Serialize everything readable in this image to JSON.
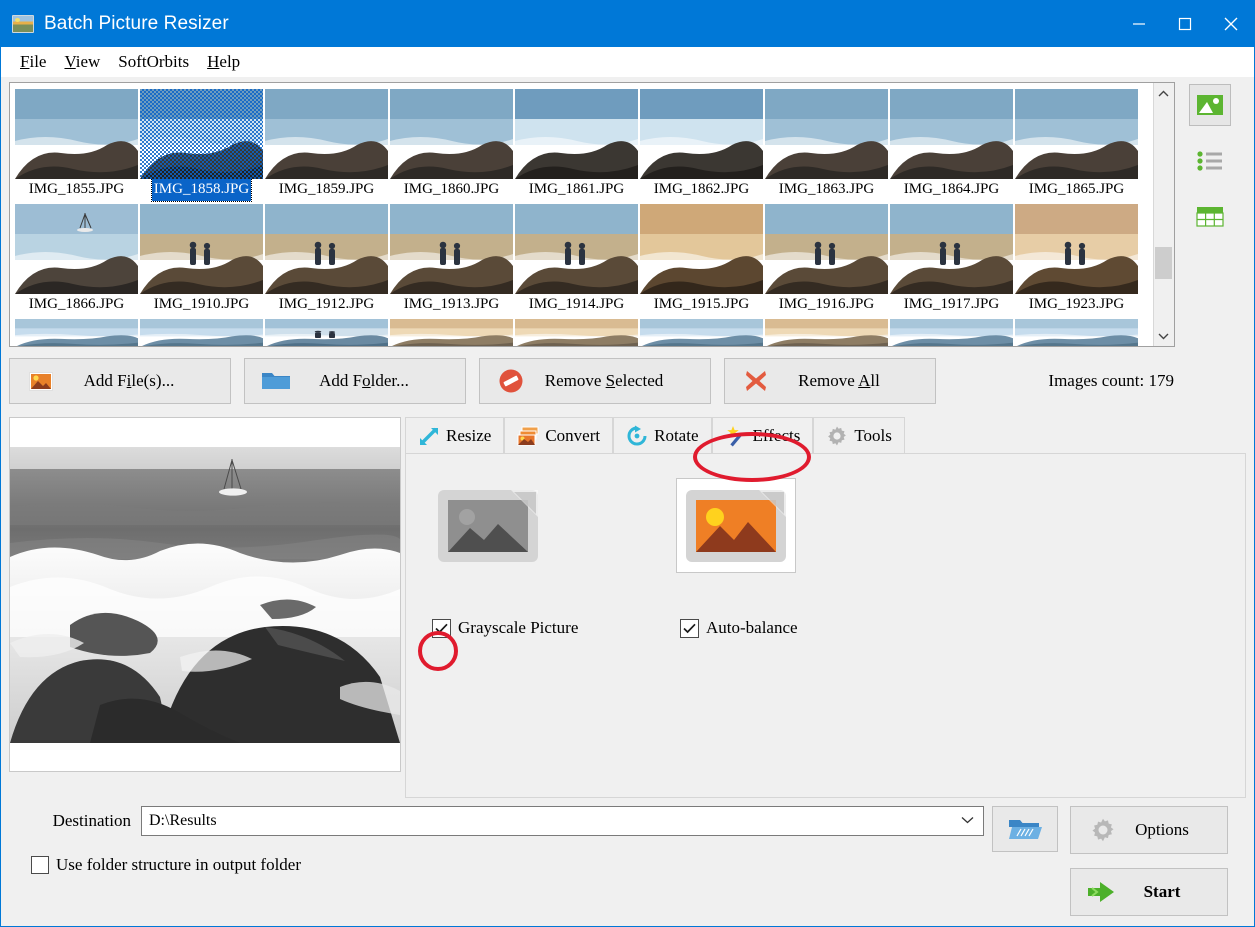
{
  "window": {
    "title": "Batch Picture Resizer",
    "icon": "app-picture-icon",
    "accent_color": "#0078d7",
    "controls": {
      "minimize": "minimize",
      "maximize": "maximize",
      "close": "close"
    }
  },
  "menubar": {
    "items": [
      {
        "label": "File",
        "mnemonic": "F"
      },
      {
        "label": "View",
        "mnemonic": "V"
      },
      {
        "label": "SoftOrbits",
        "mnemonic": ""
      },
      {
        "label": "Help",
        "mnemonic": "H"
      }
    ]
  },
  "thumbnails": {
    "selected": "IMG_1858.JPG",
    "items": [
      {
        "name": "IMG_1855.JPG",
        "kind": "rocks-sea"
      },
      {
        "name": "IMG_1858.JPG",
        "kind": "wave-splash"
      },
      {
        "name": "IMG_1859.JPG",
        "kind": "rocks-sea"
      },
      {
        "name": "IMG_1860.JPG",
        "kind": "rocks-sea"
      },
      {
        "name": "IMG_1861.JPG",
        "kind": "wave-splash"
      },
      {
        "name": "IMG_1862.JPG",
        "kind": "wave-splash"
      },
      {
        "name": "IMG_1863.JPG",
        "kind": "rocks-sea"
      },
      {
        "name": "IMG_1864.JPG",
        "kind": "rocks-sea"
      },
      {
        "name": "IMG_1865.JPG",
        "kind": "rocks-sea"
      },
      {
        "name": "IMG_1866.JPG",
        "kind": "sailboat-sea"
      },
      {
        "name": "IMG_1910.JPG",
        "kind": "people-rocks"
      },
      {
        "name": "IMG_1912.JPG",
        "kind": "people-rocks"
      },
      {
        "name": "IMG_1913.JPG",
        "kind": "people-rocks"
      },
      {
        "name": "IMG_1914.JPG",
        "kind": "people-rocks"
      },
      {
        "name": "IMG_1915.JPG",
        "kind": "rocks-sunset"
      },
      {
        "name": "IMG_1916.JPG",
        "kind": "people-rocks"
      },
      {
        "name": "IMG_1917.JPG",
        "kind": "people-rocks"
      },
      {
        "name": "IMG_1923.JPG",
        "kind": "family-sunset"
      }
    ],
    "partial_row": [
      {
        "kind": "sea-horizon"
      },
      {
        "kind": "sea-horizon"
      },
      {
        "kind": "people-sea"
      },
      {
        "kind": "sunset-sea"
      },
      {
        "kind": "sunset-sea"
      },
      {
        "kind": "sea-horizon"
      },
      {
        "kind": "sunset-sea"
      },
      {
        "kind": "sea-horizon"
      },
      {
        "kind": "sea-horizon"
      }
    ],
    "view_modes": [
      {
        "name": "thumbnail-view",
        "icon": "picture-icon",
        "active": true
      },
      {
        "name": "list-view",
        "icon": "list-icon",
        "active": false
      },
      {
        "name": "details-view",
        "icon": "table-icon",
        "active": false
      }
    ],
    "scrollbar": {
      "up": "▲",
      "down": "▼"
    }
  },
  "toolbar": {
    "add_files": {
      "label_pre": "Add F",
      "mnemonic": "i",
      "label_post": "le(s)...",
      "icon": "picture-add-icon"
    },
    "add_folder": {
      "label_pre": "Add F",
      "mnemonic": "o",
      "label_post": "lder...",
      "icon": "folder-icon"
    },
    "remove_selected": {
      "label_pre": "Remove ",
      "mnemonic": "S",
      "label_post": "elected",
      "icon": "no-entry-icon"
    },
    "remove_all": {
      "label_pre": "Remove ",
      "mnemonic": "A",
      "label_post": "ll",
      "icon": "red-x-icon"
    },
    "images_count": "Images count: 179"
  },
  "tabs": [
    {
      "label": "Resize",
      "icon": "resize-arrows-icon",
      "active": false
    },
    {
      "label": "Convert",
      "icon": "convert-images-icon",
      "active": false
    },
    {
      "label": "Rotate",
      "icon": "rotate-icon",
      "active": false
    },
    {
      "label": "Effects",
      "icon": "magic-wand-icon",
      "active": true
    },
    {
      "label": "Tools",
      "icon": "gear-icon",
      "active": false
    }
  ],
  "effects_panel": {
    "options": [
      {
        "label": "Grayscale Picture",
        "checked": true,
        "thumb": "grayscale-photo-icon",
        "thumb_selected": false
      },
      {
        "label": "Auto-balance",
        "checked": true,
        "thumb": "color-photo-icon",
        "thumb_selected": true
      }
    ]
  },
  "preview": {
    "name": "grayscale-wave-preview",
    "description": "Grayscale photo of waves breaking on rocks with a sailboat on the horizon"
  },
  "destination": {
    "label": "Destination",
    "value": "D:\\Results",
    "dropdown_arrow": "⌄",
    "browse_icon": "open-folder-icon",
    "use_folder_structure": {
      "label": "Use folder structure in output folder",
      "checked": false
    }
  },
  "actions": {
    "options": {
      "label": "Options",
      "icon": "gear-icon"
    },
    "start": {
      "label": "Start",
      "icon": "green-arrow-icon"
    }
  },
  "annotations": [
    {
      "name": "effects-tab-highlight",
      "shape": "ellipse",
      "color": "#e01b2e"
    },
    {
      "name": "grayscale-checkbox-highlight",
      "shape": "ellipse",
      "color": "#e01b2e"
    }
  ]
}
